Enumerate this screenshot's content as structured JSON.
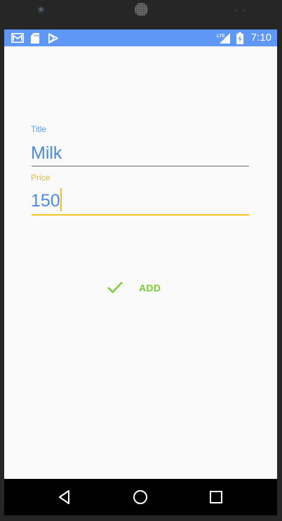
{
  "status_bar": {
    "time": "7:10",
    "network": "LTE",
    "icons": [
      "gmail-icon",
      "sd-card-icon",
      "play-store-icon",
      "lte-signal-icon",
      "battery-charging-icon"
    ],
    "color": "#5e97f6"
  },
  "form": {
    "title_label": "Title",
    "title_value": "Milk",
    "price_label": "Price",
    "price_value": "150"
  },
  "actions": {
    "add_label": "ADD",
    "accent": "#78cc2e"
  },
  "nav_bar": {
    "buttons": [
      "back-icon",
      "home-icon",
      "recents-icon"
    ]
  }
}
